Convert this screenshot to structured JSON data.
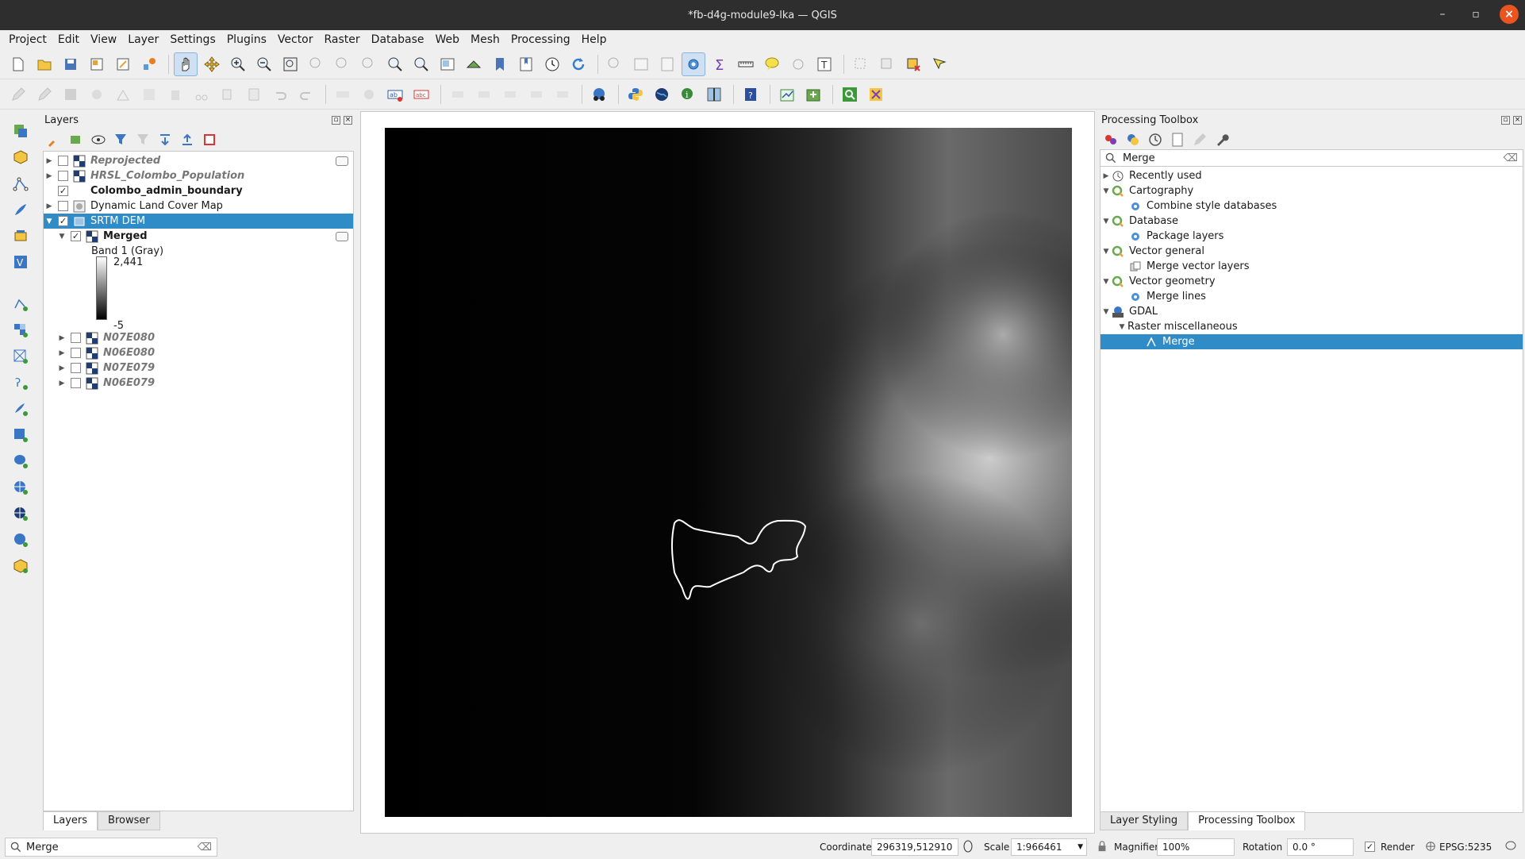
{
  "window": {
    "title": "*fb-d4g-module9-lka — QGIS"
  },
  "menu": [
    "Project",
    "Edit",
    "View",
    "Layer",
    "Settings",
    "Plugins",
    "Vector",
    "Raster",
    "Database",
    "Web",
    "Mesh",
    "Processing",
    "Help"
  ],
  "layers_panel": {
    "title": "Layers",
    "layers": [
      {
        "name": "Reprojected",
        "checked": false
      },
      {
        "name": "HRSL_Colombo_Population",
        "checked": false
      },
      {
        "name": "Colombo_admin_boundary",
        "checked": true
      },
      {
        "name": "Dynamic Land Cover Map",
        "checked": false
      },
      {
        "name": "SRTM DEM",
        "checked": true
      },
      {
        "name": "Merged",
        "checked": true
      },
      {
        "name": "N07E080",
        "checked": false
      },
      {
        "name": "N06E080",
        "checked": false
      },
      {
        "name": "N07E079",
        "checked": false
      },
      {
        "name": "N06E079",
        "checked": false
      }
    ],
    "legend": {
      "band": "Band 1 (Gray)",
      "max": "2,441",
      "min": "-5"
    },
    "tabs": [
      "Layers",
      "Browser"
    ]
  },
  "processing": {
    "title": "Processing Toolbox",
    "search_value": "Merge",
    "tree": {
      "recent": "Recently used",
      "cartography": "Cartography",
      "combine": "Combine style databases",
      "database": "Database",
      "package": "Package layers",
      "vector_general": "Vector general",
      "merge_vector": "Merge vector layers",
      "vector_geometry": "Vector geometry",
      "merge_lines": "Merge lines",
      "gdal": "GDAL",
      "raster_misc": "Raster miscellaneous",
      "merge": "Merge"
    },
    "tabs": [
      "Layer Styling",
      "Processing Toolbox"
    ]
  },
  "status": {
    "search_value": "Merge",
    "coordinate_label": "Coordinate",
    "coordinate": "296319,512910",
    "scale_label": "Scale",
    "scale": "1:966461",
    "magnifier_label": "Magnifier",
    "magnifier": "100%",
    "rotation_label": "Rotation",
    "rotation": "0.0 °",
    "render_label": "Render",
    "crs": "EPSG:5235"
  }
}
